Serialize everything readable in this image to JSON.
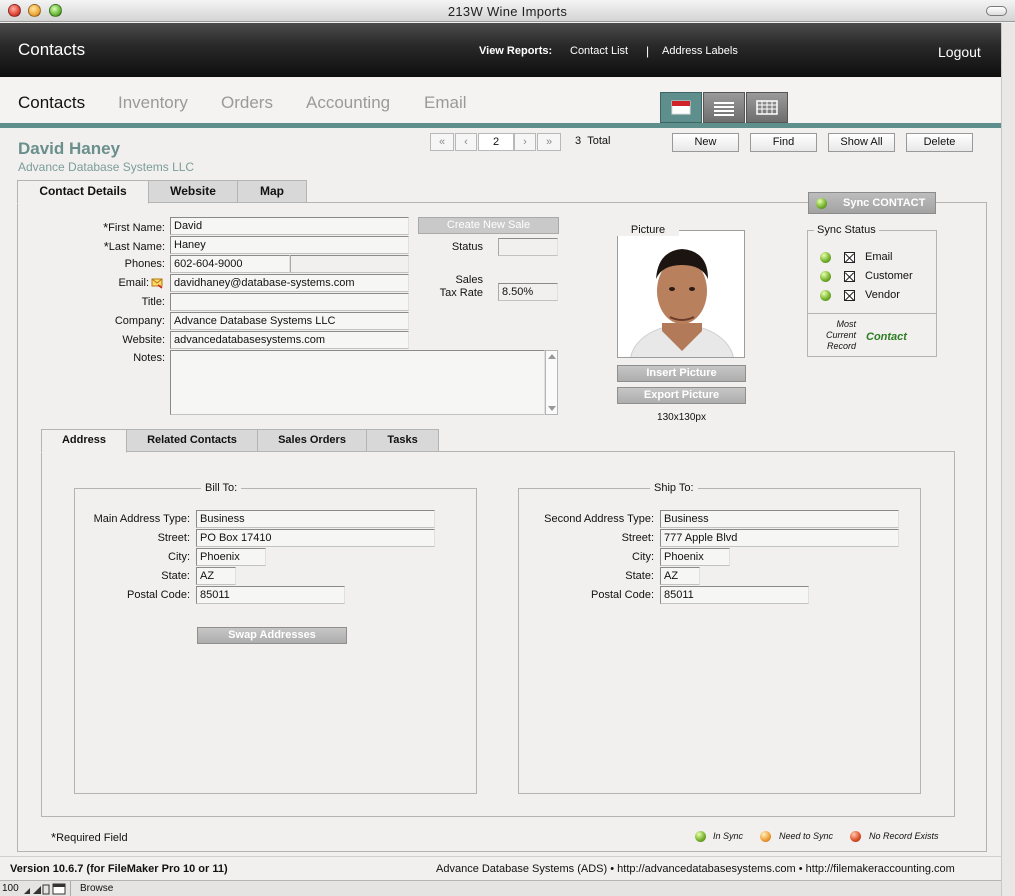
{
  "window": {
    "title": "213W Wine Imports"
  },
  "header": {
    "section": "Contacts",
    "view_reports_label": "View Reports:",
    "report_links": [
      "Contact List",
      "Address Labels"
    ],
    "separator": "|",
    "logout": "Logout"
  },
  "nav": {
    "tabs": [
      "Contacts",
      "Inventory",
      "Orders",
      "Accounting",
      "Email"
    ],
    "active": "Contacts"
  },
  "record": {
    "name": "David Haney",
    "company": "Advance Database Systems LLC",
    "current_record": "2",
    "total_count": "3",
    "total_label": "Total",
    "nav_glyphs": {
      "first": "«",
      "prev": "‹",
      "next": "›",
      "last": "»"
    }
  },
  "actions": {
    "new": "New",
    "find": "Find",
    "show_all": "Show All",
    "delete": "Delete"
  },
  "tabs": [
    "Contact Details",
    "Website",
    "Map"
  ],
  "contact": {
    "labels": {
      "first_name": "First Name:",
      "last_name": "Last Name:",
      "phones": "Phones:",
      "email": "Email:",
      "title": "Title:",
      "company": "Company:",
      "website": "Website:",
      "notes": "Notes:"
    },
    "required_mark": "*",
    "first_name": "David",
    "last_name": "Haney",
    "phone1": "602-604-9000",
    "phone2": "",
    "email": "davidhaney@database-systems.com",
    "title": "",
    "company": "Advance Database Systems LLC",
    "website": "advancedatabasesystems.com",
    "notes": ""
  },
  "sale": {
    "create_button": "Create New Sale",
    "status_label": "Status",
    "status_value": "",
    "sales_label": "Sales",
    "tax_rate_label": "Tax Rate",
    "tax_rate_value": "8.50%"
  },
  "picture": {
    "label": "Picture",
    "insert_button": "Insert Picture",
    "export_button": "Export Picture",
    "size_note": "130x130px"
  },
  "sync": {
    "button": "Sync CONTACT",
    "title": "Sync Status",
    "items": [
      {
        "label": "Email",
        "status": "green"
      },
      {
        "label": "Customer",
        "status": "green"
      },
      {
        "label": "Vendor",
        "status": "green"
      }
    ],
    "most_current_label": [
      "Most",
      "Current",
      "Record"
    ],
    "most_current_value": "Contact"
  },
  "subtabs": [
    "Address",
    "Related Contacts",
    "Sales Orders",
    "Tasks"
  ],
  "address": {
    "bill_title": "Bill To:",
    "ship_title": "Ship To:",
    "bill": {
      "type_label": "Main Address Type:",
      "type": "Business",
      "street_label": "Street:",
      "street": "PO Box 17410",
      "city_label": "City:",
      "city": "Phoenix",
      "state_label": "State:",
      "state": "AZ",
      "postal_label": "Postal Code:",
      "postal": "85011"
    },
    "ship": {
      "type_label": "Second Address Type:",
      "type": "Business",
      "street_label": "Street:",
      "street": "777 Apple Blvd",
      "city_label": "City:",
      "city": "Phoenix",
      "state_label": "State:",
      "state": "AZ",
      "postal_label": "Postal Code:",
      "postal": "85011"
    },
    "swap_button": "Swap Addresses"
  },
  "footer": {
    "required_note": "Required Field",
    "legend": [
      {
        "label": "In Sync",
        "color": "#7bb52f"
      },
      {
        "label": "Need to Sync",
        "color": "#f0a23a"
      },
      {
        "label": "No Record Exists",
        "color": "#e0562e"
      }
    ],
    "version": "Version 10.6.7 (for FileMaker Pro 10 or 11)",
    "credits": "Advance Database Systems (ADS) • http://advancedatabasesystems.com • http://filemakeraccounting.com"
  },
  "statusbar": {
    "zoom": "100",
    "mode": "Browse"
  },
  "colors": {
    "accent": "#5e8f8c",
    "header_bg": "#1a1a1a",
    "name_color": "#6a8f8d"
  }
}
